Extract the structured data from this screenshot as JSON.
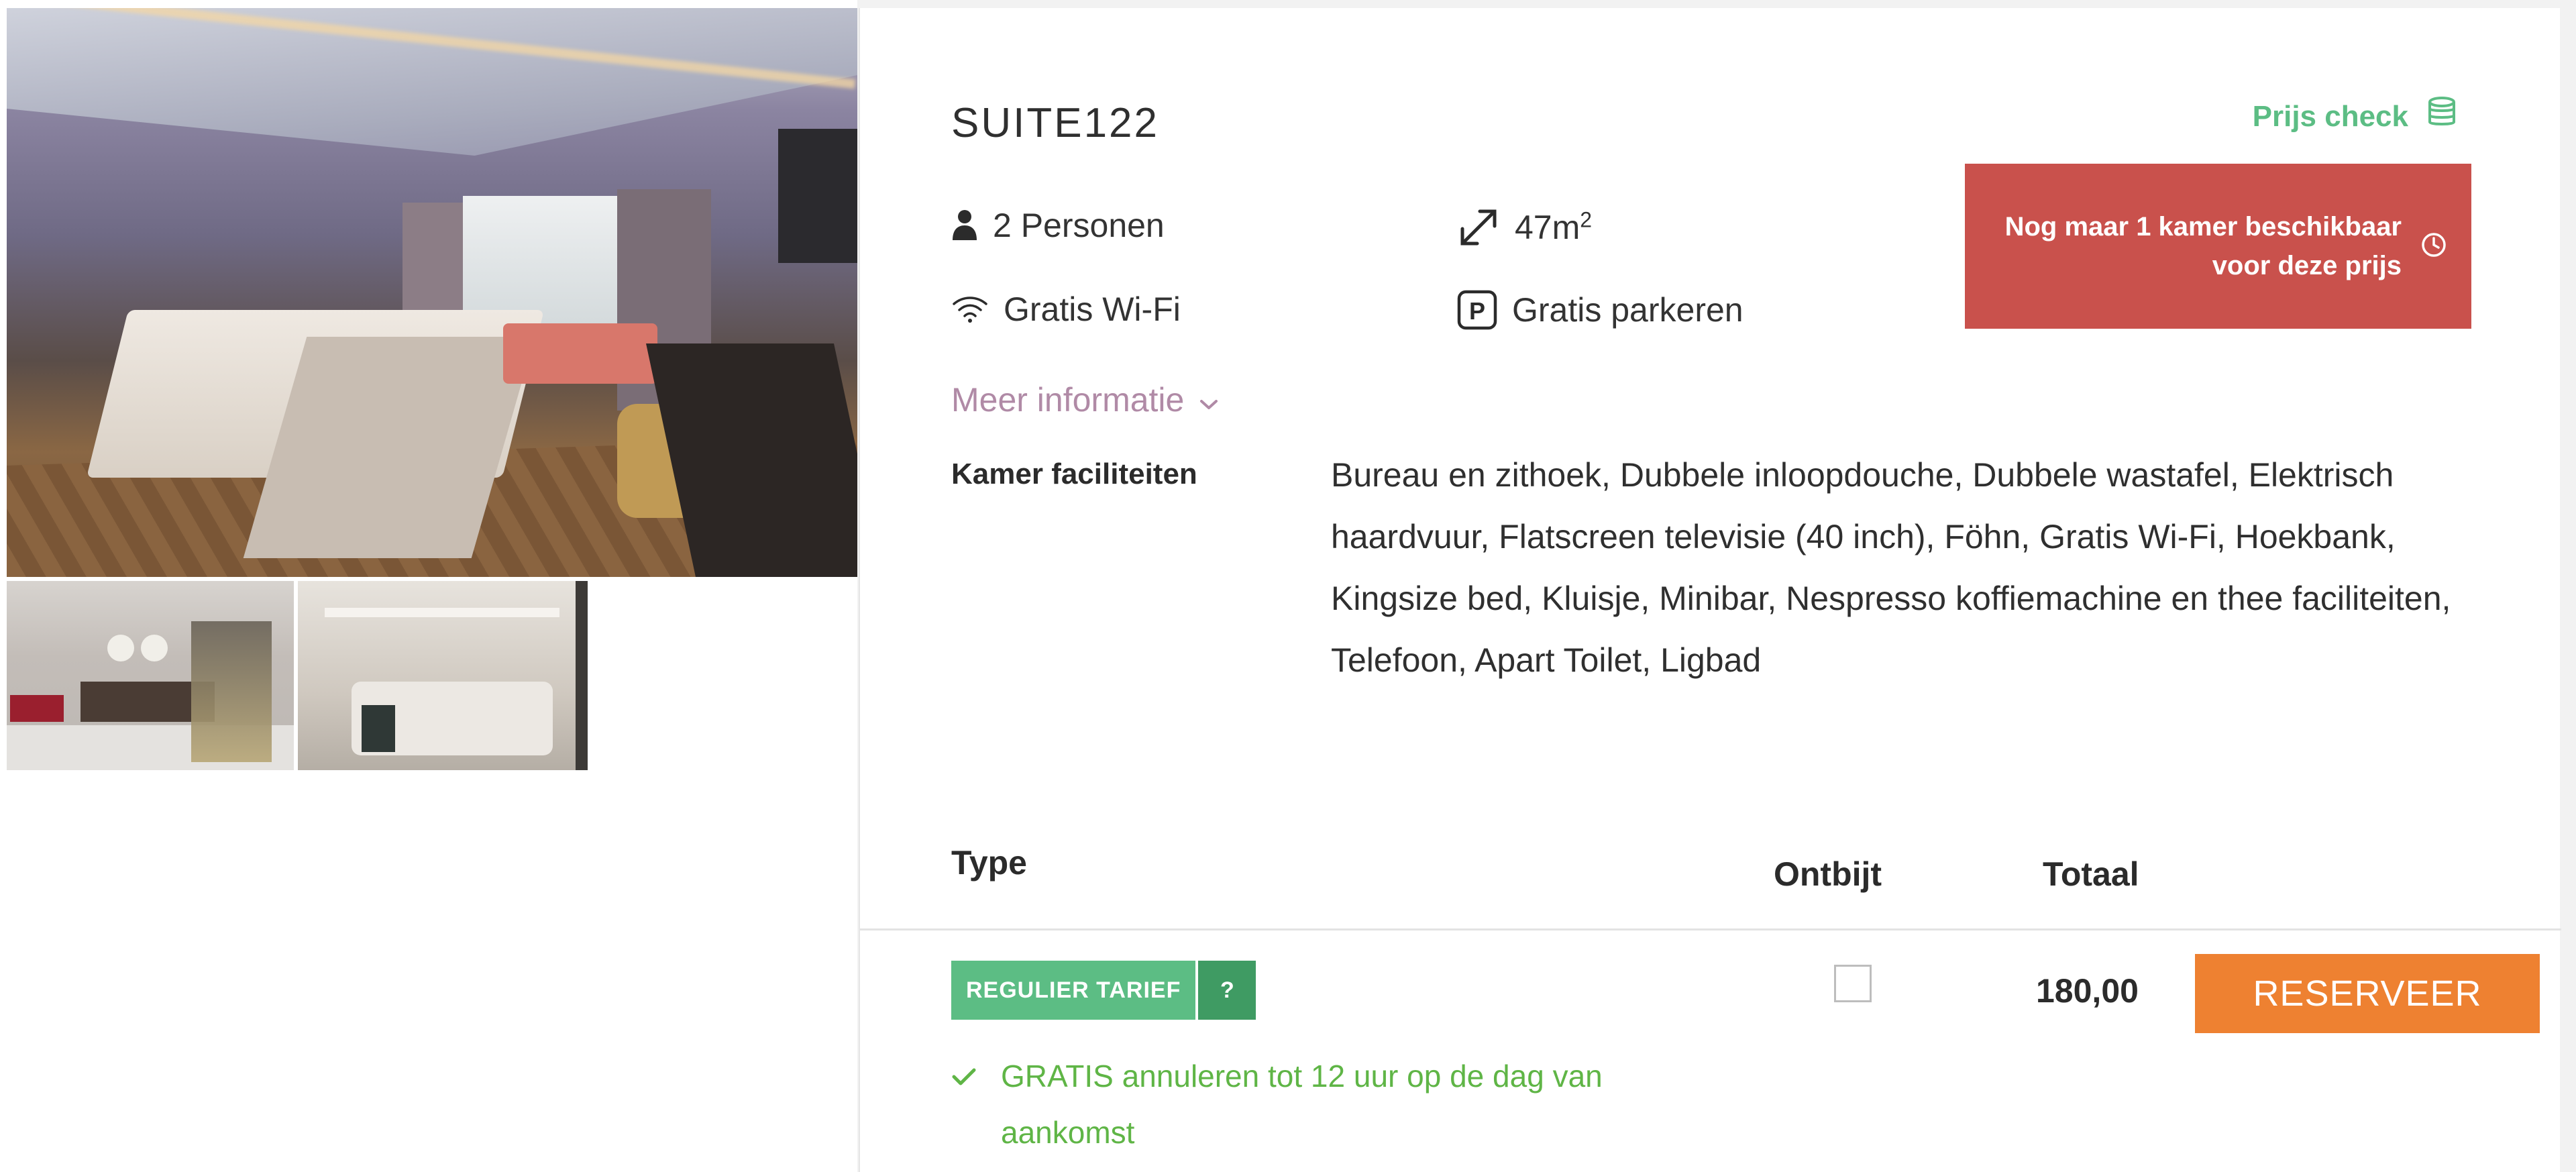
{
  "room": {
    "title": "SUITE122",
    "persons": "2 Personen",
    "size_value": "47m",
    "size_unit_sup": "2",
    "wifi": "Gratis Wi-Fi",
    "parking": "Gratis parkeren",
    "more_info": "Meer informatie",
    "facilities_label": "Kamer faciliteiten",
    "facilities_text": "Bureau en zithoek, Dubbele inloopdouche, Dubbele wastafel, Elektrisch haardvuur, Flatscreen televisie (40 inch), Föhn, Gratis Wi-Fi, Hoekbank, Kingsize bed, Kluisje, Minibar, Nespresso koffiemachine en thee faciliteiten, Telefoon, Apart Toilet, Ligbad"
  },
  "price_check": {
    "label": "Prijs check",
    "icon": "coins-icon"
  },
  "availability_alert": {
    "text": "Nog maar 1 kamer beschikbaar voor deze prijs",
    "icon": "clock-icon"
  },
  "table": {
    "headers": {
      "type": "Type",
      "breakfast": "Ontbijt",
      "total": "Totaal"
    },
    "rows": [
      {
        "rate_label": "REGULIER TARIEF",
        "help": "?",
        "cancellation": "GRATIS annuleren tot 12 uur op de dag van aankomst",
        "breakfast_checked": false,
        "price": "180,00",
        "button": "RESERVEER"
      }
    ]
  },
  "colors": {
    "green": "#5cbd84",
    "green_dark": "#3f9b63",
    "alert_red": "#c9514c",
    "reserve_orange": "#ee8131",
    "more_info_mauve": "#b08aa6",
    "cancel_green": "#5fb546"
  },
  "icons": {
    "persons": "person-icon",
    "size": "expand-arrows-icon",
    "wifi": "wifi-icon",
    "parking": "parking-icon",
    "more_info": "chevron-down-icon",
    "cancel": "checkmark-icon"
  }
}
